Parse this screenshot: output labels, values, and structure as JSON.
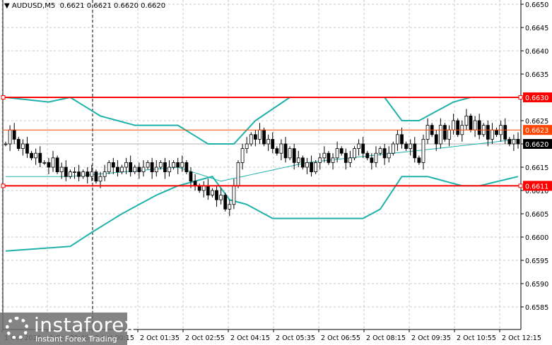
{
  "header": {
    "symbol": "AUDUSD,M5",
    "ohlc": "0.6621 0.6621 0.6620 0.6620"
  },
  "logo": {
    "name": "instaforex",
    "tagline": "Instant Forex Trading"
  },
  "colors": {
    "grid": "#c8c8c8",
    "candle": "#000000",
    "band": "#20b2aa",
    "level": "#ff0000",
    "level_mid": "#ff4500",
    "current": "#000000"
  },
  "chart_data": {
    "type": "candlestick",
    "title": "AUDUSD,M5",
    "ylim": [
      0.658,
      0.6651
    ],
    "yticks": [
      "0.6650",
      "0.6645",
      "0.6640",
      "0.6635",
      "0.6630",
      "0.6625",
      "0.6620",
      "0.6615",
      "0.6610",
      "0.6605",
      "0.6600",
      "0.6595",
      "0.6590",
      "0.6585"
    ],
    "xticks": [
      "1 Oct 2025",
      "1 Oct 22:40",
      "2 Oct 00:15",
      "2 Oct 01:35",
      "2 Oct 02:55",
      "2 Oct 04:15",
      "2 Oct 05:35",
      "2 Oct 06:55",
      "2 Oct 08:15",
      "2 Oct 09:35",
      "2 Oct 10:55",
      "2 Oct 12:15"
    ],
    "levels": [
      {
        "label": "0.6630",
        "value": 0.663,
        "color": "#ff0000"
      },
      {
        "label": "0.6623",
        "value": 0.6623,
        "color": "#ff4500"
      },
      {
        "label": "0.6611",
        "value": 0.6611,
        "color": "#ff0000"
      }
    ],
    "current": {
      "label": "0.6620",
      "value": 0.662
    },
    "closes": [
      0.662,
      0.6623,
      0.6621,
      0.6619,
      0.662,
      0.6618,
      0.6617,
      0.6618,
      0.6616,
      0.6616,
      0.6615,
      0.6617,
      0.6614,
      0.6615,
      0.6613,
      0.6614,
      0.6614,
      0.6613,
      0.6614,
      0.6613,
      0.6614,
      0.6612,
      0.6613,
      0.6614,
      0.6616,
      0.6615,
      0.6614,
      0.6615,
      0.6616,
      0.6614,
      0.6615,
      0.6614,
      0.6615,
      0.6616,
      0.6614,
      0.6615,
      0.6616,
      0.6614,
      0.6615,
      0.6616,
      0.6615,
      0.6616,
      0.6614,
      0.6612,
      0.6611,
      0.661,
      0.6611,
      0.6609,
      0.661,
      0.6608,
      0.6609,
      0.6606,
      0.6607,
      0.6611,
      0.6616,
      0.6619,
      0.662,
      0.6622,
      0.6621,
      0.6623,
      0.662,
      0.6621,
      0.6619,
      0.6618,
      0.662,
      0.6617,
      0.6619,
      0.6616,
      0.6617,
      0.6615,
      0.6616,
      0.6614,
      0.6616,
      0.6617,
      0.6618,
      0.6616,
      0.6617,
      0.6619,
      0.6618,
      0.6616,
      0.6617,
      0.6619,
      0.662,
      0.6618,
      0.6617,
      0.6616,
      0.6618,
      0.6619,
      0.6617,
      0.6618,
      0.662,
      0.6622,
      0.662,
      0.6619,
      0.662,
      0.6617,
      0.6616,
      0.6621,
      0.6624,
      0.6622,
      0.662,
      0.6624,
      0.6621,
      0.6623,
      0.6625,
      0.6622,
      0.6624,
      0.6626,
      0.6623,
      0.6625,
      0.6622,
      0.6624,
      0.6621,
      0.6623,
      0.6622,
      0.6624,
      0.6621,
      0.662,
      0.6621,
      0.662
    ],
    "bands": {
      "upper": [
        [
          0,
          0.663
        ],
        [
          10,
          0.6629
        ],
        [
          15,
          0.663
        ],
        [
          22,
          0.6626
        ],
        [
          30,
          0.6624
        ],
        [
          40,
          0.6624
        ],
        [
          47,
          0.662
        ],
        [
          53,
          0.662
        ],
        [
          58,
          0.6625
        ],
        [
          66,
          0.663
        ],
        [
          88,
          0.663
        ],
        [
          92,
          0.6625
        ],
        [
          96,
          0.6625
        ],
        [
          104,
          0.6629
        ],
        [
          108,
          0.663
        ],
        [
          119,
          0.663
        ]
      ],
      "middle": [
        [
          0,
          0.6613
        ],
        [
          15,
          0.6613
        ],
        [
          40,
          0.6615
        ],
        [
          50,
          0.6612
        ],
        [
          55,
          0.6613
        ],
        [
          70,
          0.6616
        ],
        [
          90,
          0.6618
        ],
        [
          100,
          0.6619
        ],
        [
          119,
          0.6621
        ]
      ],
      "lower": [
        [
          0,
          0.6597
        ],
        [
          15,
          0.6598
        ],
        [
          20,
          0.6601
        ],
        [
          27,
          0.6605
        ],
        [
          35,
          0.6609
        ],
        [
          40,
          0.6611
        ],
        [
          48,
          0.6613
        ],
        [
          52,
          0.6608
        ],
        [
          56,
          0.6607
        ],
        [
          62,
          0.6604
        ],
        [
          83,
          0.6604
        ],
        [
          87,
          0.6606
        ],
        [
          92,
          0.6613
        ],
        [
          98,
          0.6613
        ],
        [
          106,
          0.6611
        ],
        [
          110,
          0.6611
        ],
        [
          119,
          0.6613
        ]
      ]
    }
  }
}
